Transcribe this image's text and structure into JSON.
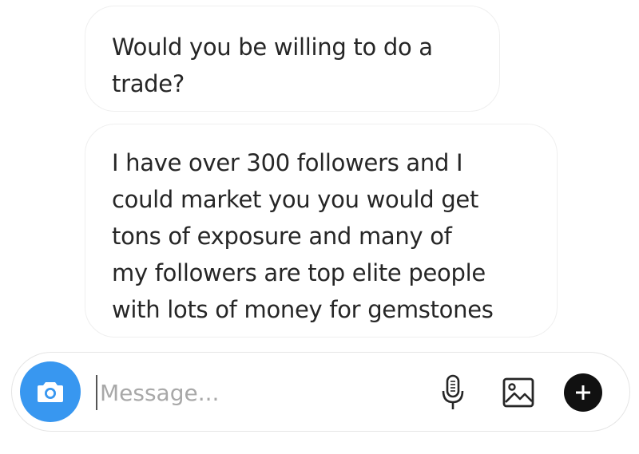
{
  "messages": [
    {
      "lines": [
        "Would you be willing to do a",
        "trade?"
      ]
    },
    {
      "lines": [
        "I have over 300 followers and I",
        "could market you you would get",
        "tons of exposure and many of",
        "my followers are top elite people",
        "with lots of money for gemstones"
      ]
    }
  ],
  "composer": {
    "placeholder": "Message...",
    "value": "",
    "icons": {
      "camera": "camera-icon",
      "mic": "microphone-icon",
      "gallery": "gallery-icon",
      "add": "plus-icon"
    }
  },
  "colors": {
    "accent": "#3897f0",
    "text": "#262626",
    "placeholder": "#a8a8a8",
    "bubble_border": "#efefef"
  }
}
